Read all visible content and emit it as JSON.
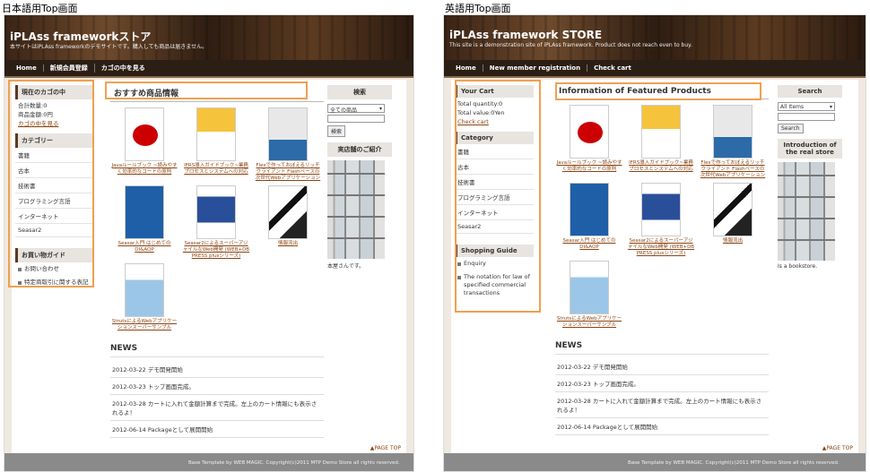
{
  "captions": {
    "jp": "日本語用Top画面",
    "en": "英語用Top画面"
  },
  "colors": {
    "highlight": "#f0a050",
    "nav": "#2b1e14",
    "link": "#8b4513"
  },
  "jp": {
    "header": {
      "title": "iPLAss frameworkストア",
      "subtitle": "本サイトはiPLAss frameworkのデモサイトです。購入しても商品は届きません。"
    },
    "nav": [
      "Home",
      "新規会員登録",
      "カゴの中を見る"
    ],
    "cart": {
      "title": "現在のカゴの中",
      "qty": "合計数量:0",
      "value": "商品金額:0円",
      "link": "カゴの中を見る"
    },
    "category": {
      "title": "カテゴリー",
      "items": [
        "書籍",
        "古本",
        "技術書",
        "プログラミング言語",
        "インターネット",
        "Seasar2"
      ]
    },
    "guide": {
      "title": "お買い物ガイド",
      "items": [
        "お問い合わせ",
        "特定商取引に関する表記"
      ]
    },
    "featured": "おすすめ商品情報",
    "books": [
      "Javaルールブック ~読みやすく効率的なコードの原則",
      "IFRS導入ガイドブック~業務プロセスとシステムへの対応",
      "Flexで作っておぼえるリッチクライアント Flashベースの次世代Webアプリケーション",
      "Seasar入門 はじめてのDI&AOP",
      "Seasar2によるスーパーアジャイルなWeb開発 (WEB+DB PRESS plusシリーズ)",
      "情報流出",
      "StrutsによるWebアプリケーションスーパーサンプル"
    ],
    "news": {
      "title": "NEWS",
      "items": [
        "2012-03-22 デモ開発開始",
        "2012-03-23 トップ画面完成。",
        "2012-03-28 カートに入れて金額計算まで完成。左上のカート情報にも表示されるよ！",
        "2012-06-14 Packageとして展開開始"
      ]
    },
    "search": {
      "title": "検索",
      "option": "全ての商品",
      "button": "検索"
    },
    "store": {
      "title": "実店舗のご紹介",
      "caption": "本屋さんです。"
    },
    "pagetop": "▲PAGE TOP",
    "footer": "Base Template by WEB MAGIC. Copyright(c)2011 MTP Demo Store all rights reserved."
  },
  "en": {
    "header": {
      "title": "iPLAss framework STORE",
      "subtitle": "This site is a demonstration site of iPLAss framework. Product does not reach even to buy."
    },
    "nav": [
      "Home",
      "New member registration",
      "Check cart"
    ],
    "cart": {
      "title": "Your Cart",
      "qty": "Total quantity:0",
      "value": "Total value:0Yen",
      "link": "Check cart"
    },
    "category": {
      "title": "Category",
      "items": [
        "書籍",
        "古本",
        "技術書",
        "プログラミング言語",
        "インターネット",
        "Seasar2"
      ]
    },
    "guide": {
      "title": "Shopping Guide",
      "items": [
        "Enquiry",
        "The notation for law of specified commercial transactions"
      ]
    },
    "featured": "Information of Featured Products",
    "books": [
      "Javaルールブック ~読みやすく効率的なコードの原則",
      "IFRS導入ガイドブック~業務プロセスとシステムへの対応",
      "Flexで作っておぼえるリッチクライアント Flashベースの次世代Webアプリケーション",
      "Seasar入門 はじめてのDI&AOP",
      "Seasar2によるスーパーアジャイルなWeb開発 (WEB+DB PRESS plusシリーズ)",
      "情報流出",
      "StrutsによるWebアプリケーションスーパーサンプル"
    ],
    "news": {
      "title": "NEWS",
      "items": [
        "2012-03-22 デモ開発開始",
        "2012-03-23 トップ画面完成。",
        "2012-03-28 カートに入れて金額計算まで完成。左上のカート情報にも表示されるよ！",
        "2012-06-14 Packageとして展開開始"
      ]
    },
    "search": {
      "title": "Search",
      "option": "All Items",
      "button": "Search"
    },
    "store": {
      "title": "Introduction of the real store",
      "caption": "Is a bookstore."
    },
    "pagetop": "▲PAGE TOP",
    "footer": "Base Template by WEB MAGIC. Copyright(c)2011 MTP Demo Store all rights reserved."
  }
}
